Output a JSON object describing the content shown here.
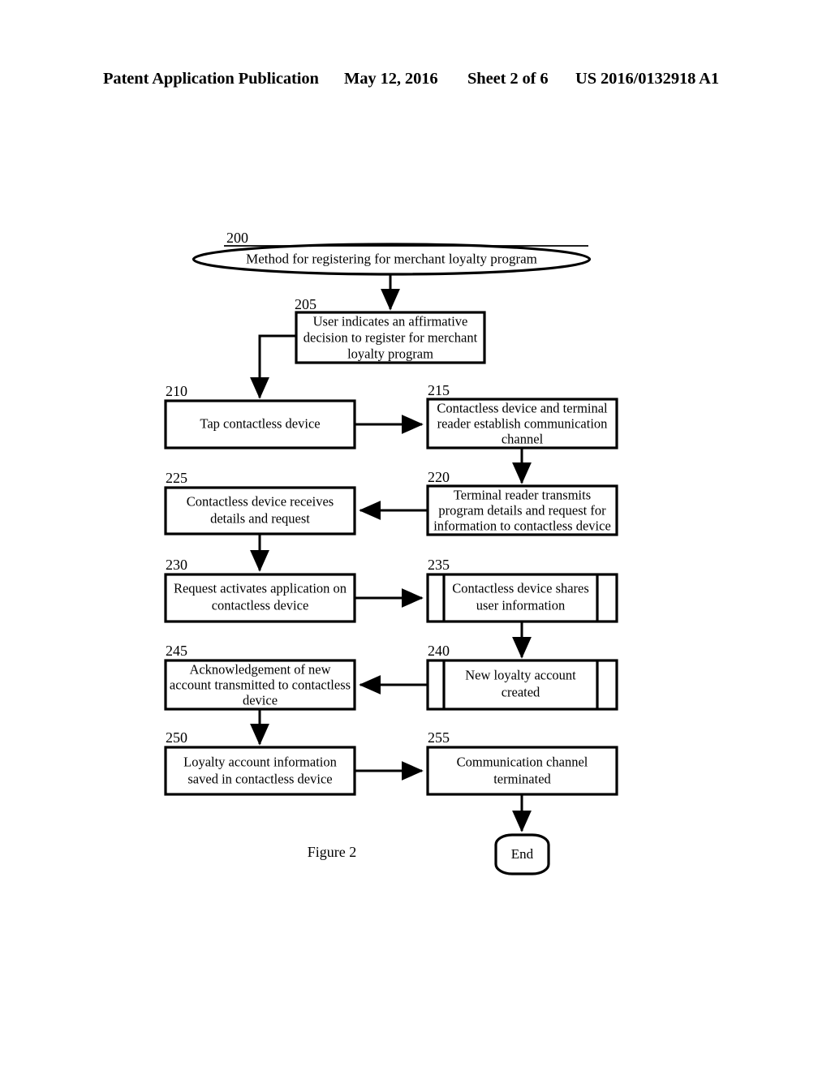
{
  "header": {
    "title": "Patent Application Publication",
    "date": "May 12, 2016",
    "sheet": "Sheet 2 of 6",
    "publication_number": "US 2016/0132918 A1"
  },
  "figure": {
    "caption": "Figure 2"
  },
  "flowchart": {
    "start": {
      "ref": "200",
      "label": "Method for registering for merchant loyalty program",
      "shape": "ellipse"
    },
    "end": {
      "label": "End",
      "shape": "rounded-terminator"
    },
    "steps": [
      {
        "ref": "205",
        "shape": "process",
        "lines": [
          "User indicates an affirmative",
          "decision to register for merchant",
          "loyalty program"
        ]
      },
      {
        "ref": "210",
        "shape": "process",
        "lines": [
          "Tap contactless device"
        ]
      },
      {
        "ref": "215",
        "shape": "process",
        "lines": [
          "Contactless device and terminal",
          "reader establish communication",
          "channel"
        ]
      },
      {
        "ref": "220",
        "shape": "process",
        "lines": [
          "Terminal reader transmits",
          "program details and request for",
          "information to contactless device"
        ]
      },
      {
        "ref": "225",
        "shape": "process",
        "lines": [
          "Contactless device receives",
          "details and request"
        ]
      },
      {
        "ref": "230",
        "shape": "process",
        "lines": [
          "Request activates application on",
          "contactless device"
        ]
      },
      {
        "ref": "235",
        "shape": "predefined-process",
        "lines": [
          "Contactless device shares",
          "user information"
        ]
      },
      {
        "ref": "240",
        "shape": "predefined-process",
        "lines": [
          "New loyalty account",
          "created"
        ]
      },
      {
        "ref": "245",
        "shape": "process",
        "lines": [
          "Acknowledgement of new",
          "account transmitted to contactless",
          "device"
        ]
      },
      {
        "ref": "250",
        "shape": "process",
        "lines": [
          "Loyalty account information",
          "saved in contactless device"
        ]
      },
      {
        "ref": "255",
        "shape": "process",
        "lines": [
          "Communication channel",
          "terminated"
        ]
      }
    ]
  },
  "colors": {
    "ink": "#000000",
    "paper": "#ffffff"
  }
}
